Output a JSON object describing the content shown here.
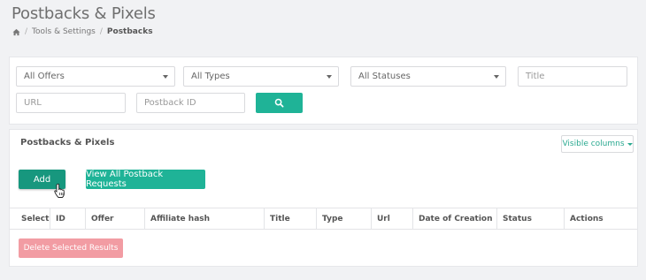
{
  "page": {
    "title": "Postbacks & Pixels"
  },
  "breadcrumb": {
    "items": [
      "Tools & Settings",
      "Postbacks"
    ]
  },
  "filters": {
    "offers": "All Offers",
    "types": "All Types",
    "statuses": "All Statuses",
    "title_placeholder": "Title",
    "url_placeholder": "URL",
    "postback_id_placeholder": "Postback ID"
  },
  "results": {
    "title": "Postbacks & Pixels",
    "visible_columns_label": "Visible columns",
    "add_label": "Add",
    "view_all_label": "View All Postback Requests",
    "delete_label": "Delete Selected Results",
    "columns": [
      "Select",
      "ID",
      "Offer",
      "Affiliate hash",
      "Title",
      "Type",
      "Url",
      "Date of Creation",
      "Status",
      "Actions"
    ]
  },
  "colors": {
    "accent": "#1fb397",
    "accent_dark": "#17977e",
    "danger_light": "#f29ca3"
  }
}
